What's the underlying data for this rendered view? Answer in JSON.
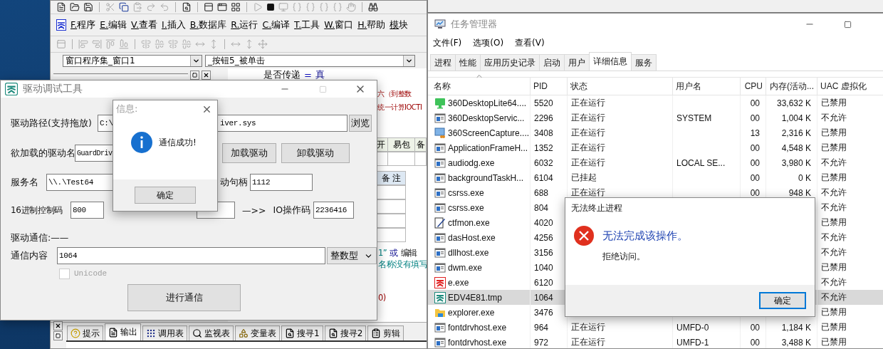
{
  "ide": {
    "menu": [
      "F.程序",
      "E.编辑",
      "V.查看",
      "I.插入",
      "B.数据库",
      "R.运行",
      "C.编译",
      "T.工具",
      "W.窗口",
      "H.帮助",
      "模块"
    ],
    "selectors": [
      {
        "value": "窗口程序集_窗口1"
      },
      {
        "value": "_按钮5_被单击"
      }
    ],
    "code_line": {
      "name": "是否传递",
      "op": "=",
      "value": "真"
    },
    "fragments_top": [
      {
        "text": "六（到整数",
        "kind": "call"
      },
      {
        "text": "统一计算IOCTI",
        "kind": "call"
      }
    ],
    "table_header": [
      "开",
      "易包",
      "备"
    ],
    "table2_header": "备 注",
    "fragments_bottom": [
      {
        "parts": [
          {
            "text": "1”",
            "kind": "string"
          },
          {
            "text": "或",
            "kind": "keyword"
          },
          {
            "text": "编辑",
            "kind": "plain"
          }
        ]
      },
      {
        "parts": [
          {
            "text": "名称没有填写",
            "kind": "string"
          }
        ]
      },
      {
        "parts": [
          {
            "text": "0)",
            "kind": "call"
          }
        ]
      }
    ],
    "bottom_tabs": [
      {
        "label": "提示",
        "kind": "help",
        "selected": false
      },
      {
        "label": "输出",
        "kind": "doc",
        "selected": true
      },
      {
        "label": "调用表",
        "kind": "grid",
        "selected": false
      },
      {
        "label": "监视表",
        "kind": "search",
        "selected": false
      },
      {
        "label": "变量表",
        "kind": "shapes",
        "selected": false
      },
      {
        "label": "搜寻1",
        "kind": "find",
        "selected": false
      },
      {
        "label": "搜寻2",
        "kind": "find",
        "selected": false
      },
      {
        "label": "剪辑",
        "kind": "list",
        "selected": false
      }
    ]
  },
  "driver_tool": {
    "title": "驱动调试工具",
    "path": {
      "label": "驱动路径(支持拖放)",
      "value_start": "C:\\",
      "value_end": "iver.sys"
    },
    "browse_button": "浏览",
    "driver_name": {
      "label": "欲加载的驱动名",
      "value": "GuardDriv"
    },
    "load_button": "加载驱动",
    "unload_button": "卸载驱动",
    "service": {
      "label": "服务名",
      "value": "\\\\.\\Test64"
    },
    "handle": {
      "label": "动句柄",
      "value": "1112"
    },
    "control": {
      "label": "16进制控制码",
      "value": "800"
    },
    "io_code": {
      "arrow": "—>>",
      "label": "IO操作码",
      "value": "2236416"
    },
    "section_label": "驱动通信:——",
    "content": {
      "label": "通信内容",
      "value": "1064"
    },
    "type_select": "整数型",
    "unicode": {
      "label": "Unicode",
      "checked": false,
      "disabled": true
    },
    "send_button": "进行通信"
  },
  "info_dialog": {
    "title": "信息:",
    "message": "通信成功!",
    "ok_button": "确定"
  },
  "task_manager": {
    "title": "任务管理器",
    "menu": [
      "文件(F)",
      "选项(O)",
      "查看(V)"
    ],
    "tabs": [
      {
        "label": "进程",
        "selected": false
      },
      {
        "label": "性能",
        "selected": false
      },
      {
        "label": "应用历史记录",
        "selected": false
      },
      {
        "label": "启动",
        "selected": false
      },
      {
        "label": "用户",
        "selected": false
      },
      {
        "label": "详细信息",
        "selected": true
      },
      {
        "label": "服务",
        "selected": false
      }
    ],
    "columns": [
      "名称",
      "PID",
      "状态",
      "用户名",
      "CPU",
      "内存(活动...",
      "UAC 虚拟化"
    ],
    "rows": [
      {
        "kind": "monitor",
        "name": "360DesktopLite64....",
        "pid": "5520",
        "status": "正在运行",
        "cpu": "00",
        "memory": "33,632 K",
        "uac": "已禁用",
        "selected": false
      },
      {
        "kind": "window",
        "name": "360DesktopServic...",
        "pid": "2296",
        "status": "正在运行",
        "user": "SYSTEM",
        "cpu": "00",
        "memory": "1,004 K",
        "uac": "不允许",
        "selected": false
      },
      {
        "kind": "capture",
        "name": "360ScreenCapture....",
        "pid": "3408",
        "status": "正在运行",
        "cpu": "13",
        "memory": "2,316 K",
        "uac": "已禁用",
        "selected": false
      },
      {
        "kind": "window",
        "name": "ApplicationFrameH...",
        "pid": "1352",
        "status": "正在运行",
        "cpu": "00",
        "memory": "4,548 K",
        "uac": "已禁用",
        "selected": false
      },
      {
        "kind": "window",
        "name": "audiodg.exe",
        "pid": "6032",
        "status": "正在运行",
        "user": "LOCAL SE...",
        "cpu": "00",
        "memory": "3,980 K",
        "uac": "不允许",
        "selected": false
      },
      {
        "kind": "window",
        "name": "backgroundTaskH...",
        "pid": "6104",
        "status": "已挂起",
        "cpu": "00",
        "memory": "0 K",
        "uac": "已禁用",
        "selected": false
      },
      {
        "kind": "window",
        "name": "csrss.exe",
        "pid": "688",
        "status": "正在运行",
        "cpu": "00",
        "memory": "948 K",
        "uac": "不允许",
        "selected": false
      },
      {
        "kind": "window",
        "name": "csrss.exe",
        "pid": "804",
        "uac": "不允许",
        "selected": false
      },
      {
        "kind": "pen",
        "name": "ctfmon.exe",
        "pid": "4020",
        "uac": "已禁用",
        "selected": false
      },
      {
        "kind": "window",
        "name": "dasHost.exe",
        "pid": "4256",
        "uac": "不允许",
        "selected": false
      },
      {
        "kind": "window",
        "name": "dllhost.exe",
        "pid": "3156",
        "uac": "不允许",
        "selected": false
      },
      {
        "kind": "window",
        "name": "dwm.exe",
        "pid": "1040",
        "uac": "已禁用",
        "selected": false
      },
      {
        "kind": "logo",
        "name": "e.exe",
        "pid": "6120",
        "uac": "不允许",
        "selected": false
      },
      {
        "kind": "tool",
        "name": "EDV4E81.tmp",
        "pid": "1064",
        "uac": "不允许",
        "selected": true
      },
      {
        "kind": "folder",
        "name": "explorer.exe",
        "pid": "3476",
        "uac": "已禁用",
        "selected": false
      },
      {
        "kind": "window",
        "name": "fontdrvhost.exe",
        "pid": "964",
        "status": "正在运行",
        "user": "UMFD-0",
        "cpu": "00",
        "memory": "1,184 K",
        "uac": "已禁用",
        "selected": false
      },
      {
        "kind": "window",
        "name": "fontdrvhost.exe",
        "pid": "972",
        "status": "正在运行",
        "user": "UMFD-1",
        "cpu": "00",
        "memory": "3,488 K",
        "uac": "已禁用",
        "selected": false
      }
    ]
  },
  "error_dialog": {
    "title": "无法终止进程",
    "heading": "无法完成该操作。",
    "message": "拒绝访问。",
    "ok_button": "确定"
  }
}
